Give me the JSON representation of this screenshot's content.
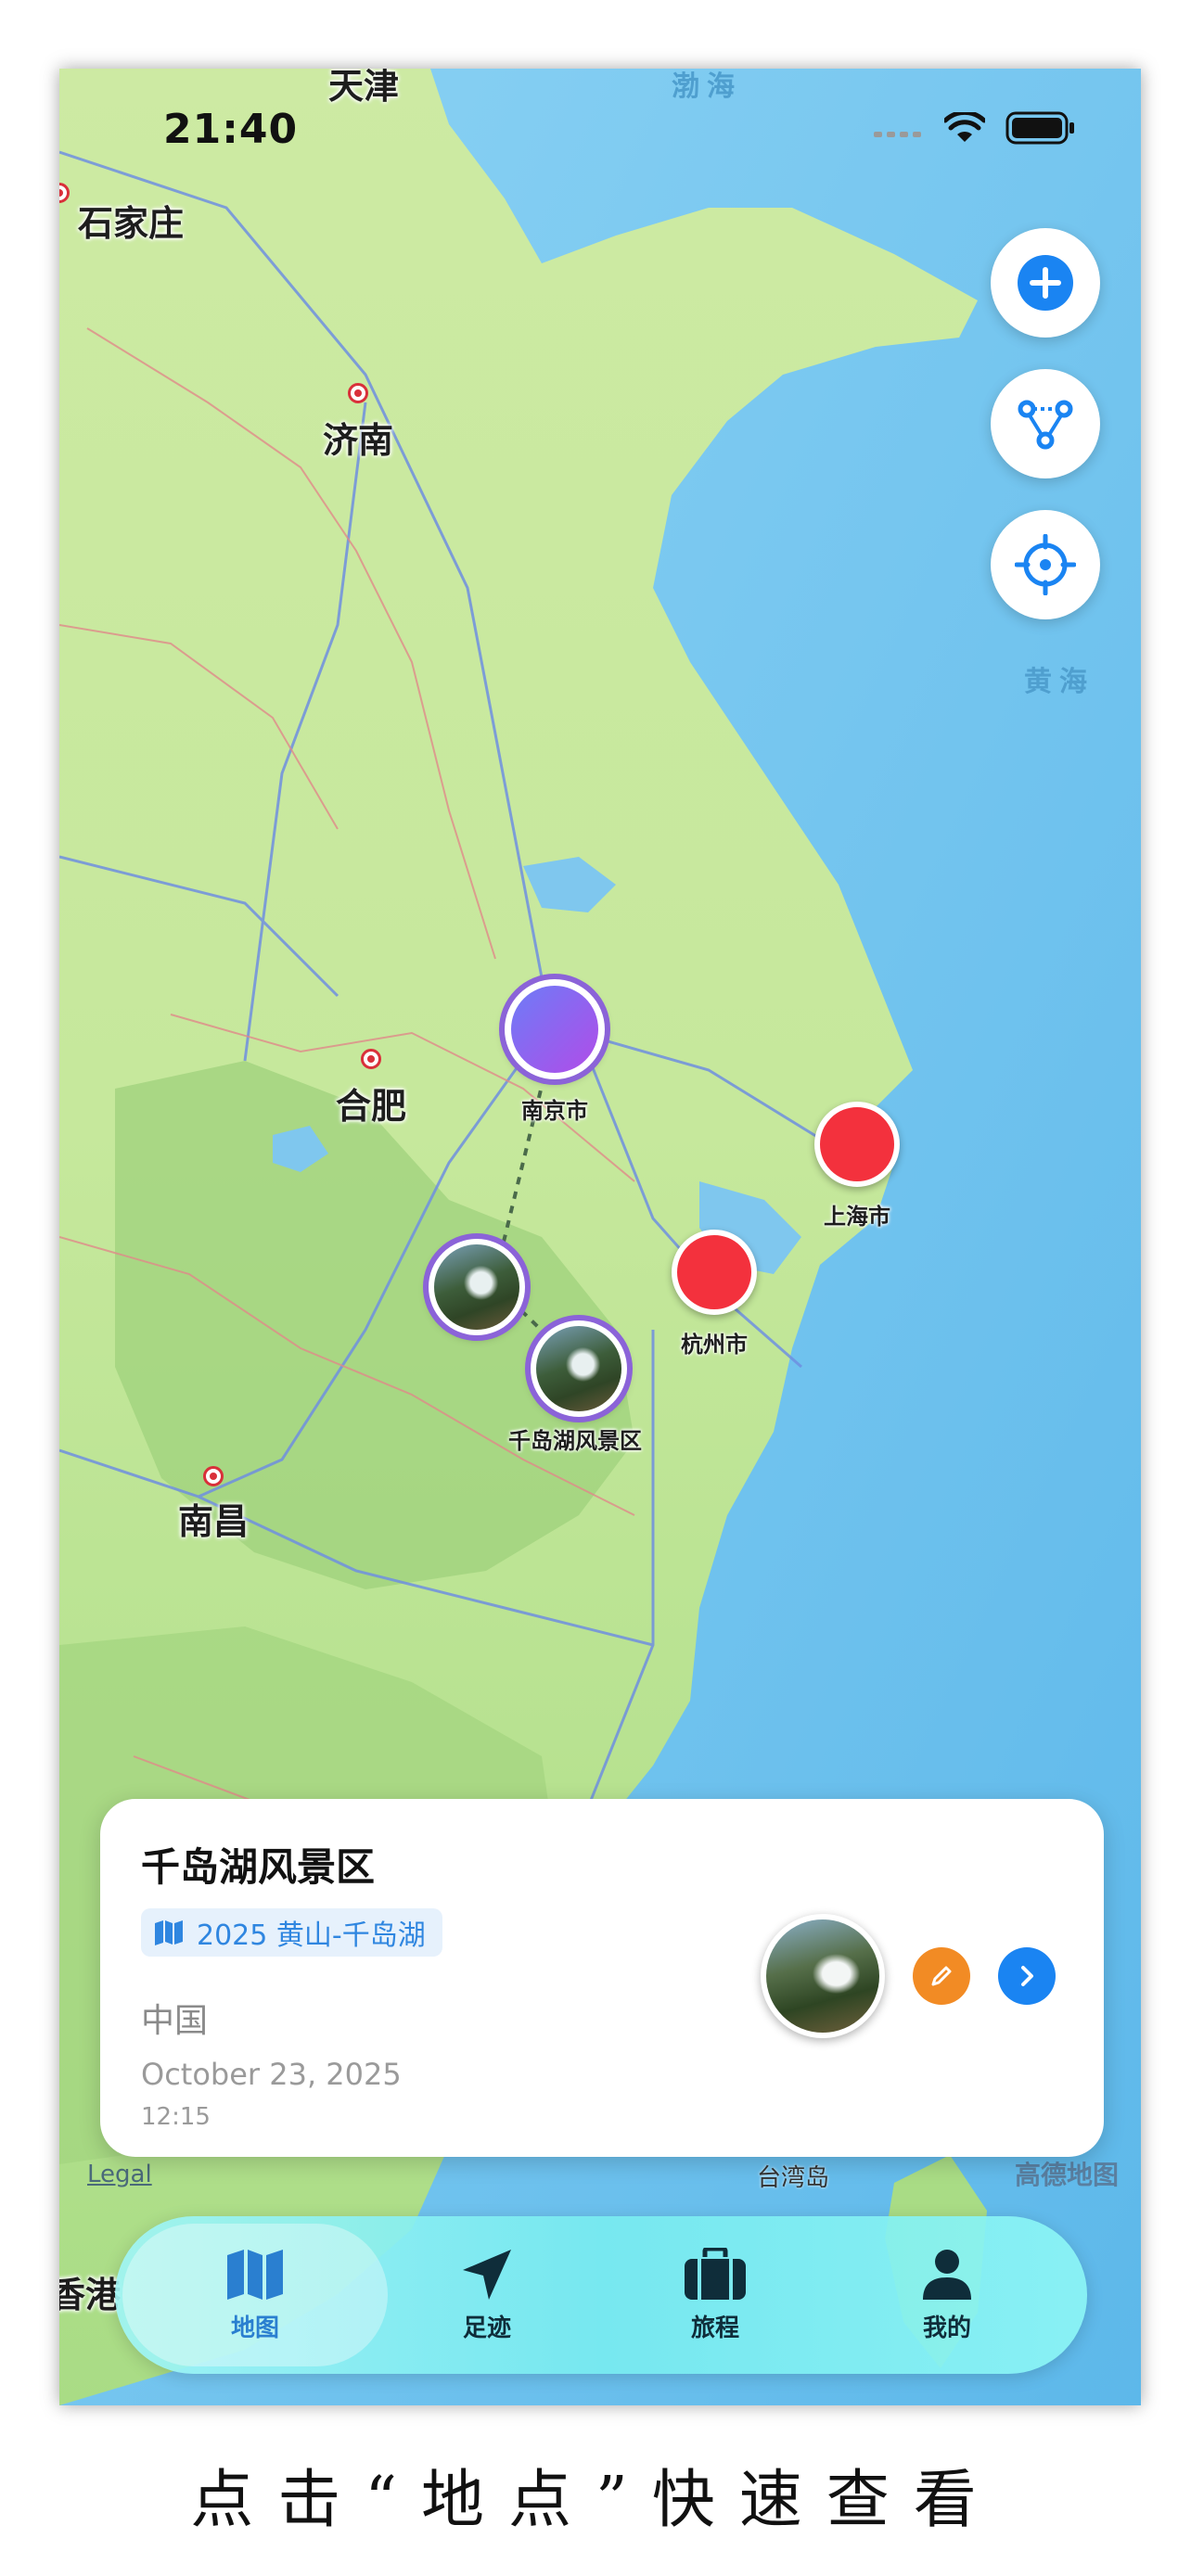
{
  "status_bar": {
    "time": "21:40"
  },
  "map": {
    "cities": [
      "石家庄",
      "济南",
      "合肥",
      "南昌",
      "天津",
      "香港"
    ],
    "seas": [
      "黄海",
      "渤海"
    ],
    "pins": [
      {
        "label": "南京市",
        "kind": "purple"
      },
      {
        "label": "上海市",
        "kind": "red"
      },
      {
        "label": "杭州市",
        "kind": "red"
      },
      {
        "label": "千岛湖风景区",
        "kind": "photo"
      }
    ],
    "island": "台湾岛",
    "attribution_line1": "高德地图",
    "attribution_line2": "…",
    "legal": "Legal"
  },
  "side_buttons": {
    "add_icon": "plus-icon",
    "route_icon": "route-icon",
    "locate_icon": "crosshair-icon"
  },
  "card": {
    "title": "千岛湖风景区",
    "trip_chip": "2025 黄山-千岛湖",
    "country": "中国",
    "date": "October 23, 2025",
    "time": "12:15",
    "edit_icon": "pencil-icon",
    "next_icon": "chevron-right-icon",
    "colors": {
      "edit": "#f28b24",
      "next": "#1a84f2"
    }
  },
  "tabbar": {
    "tabs": [
      {
        "label": "地图",
        "icon": "map-icon",
        "active": true
      },
      {
        "label": "足迹",
        "icon": "location-arrow-icon",
        "active": false
      },
      {
        "label": "旅程",
        "icon": "suitcase-icon",
        "active": false
      },
      {
        "label": "我的",
        "icon": "person-icon",
        "active": false
      }
    ]
  },
  "caption": "点击“地点”快速查看"
}
